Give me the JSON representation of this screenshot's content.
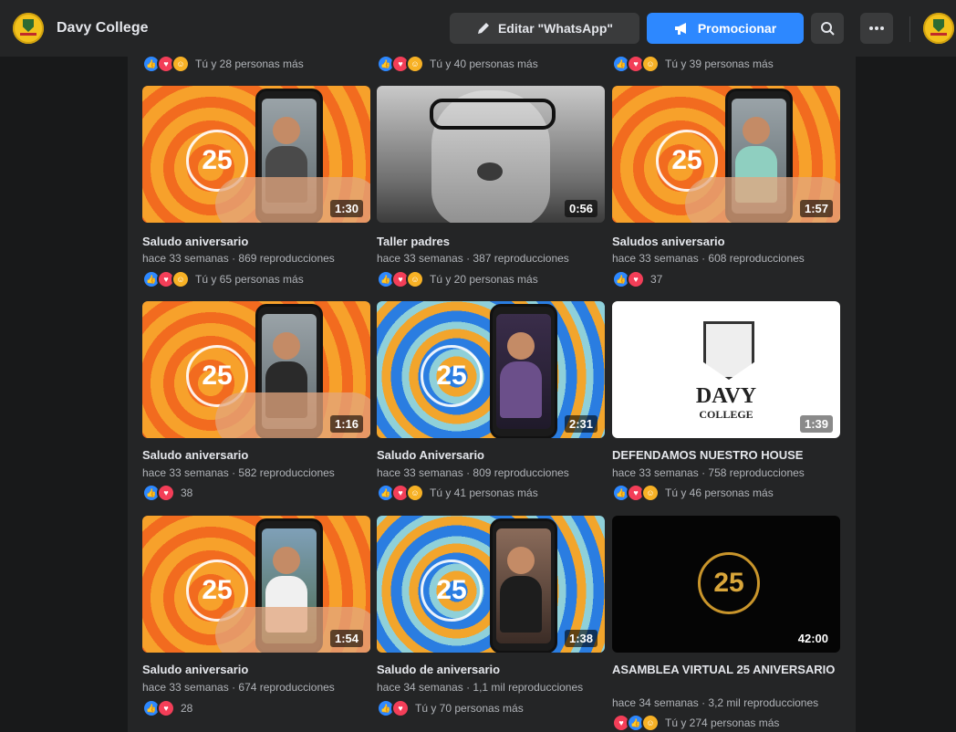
{
  "header": {
    "page_name": "Davy College",
    "edit_label": "Editar \"WhatsApp\"",
    "promote_label": "Promocionar"
  },
  "top_row_reactions": [
    {
      "text": "Tú y 28 personas más"
    },
    {
      "text": "Tú y 40 personas más"
    },
    {
      "text": "Tú y 39 personas más"
    }
  ],
  "videos": [
    {
      "title": "Saludo aniversario",
      "age": "hace 33 semanas",
      "views": "869 reproducciones",
      "duration": "1:30",
      "reactions": "Tú y 65 personas más",
      "thumb": "orange"
    },
    {
      "title": "Taller padres",
      "age": "hace 33 semanas",
      "views": "387 reproducciones",
      "duration": "0:56",
      "reactions": "Tú y 20 personas más",
      "thumb": "gray"
    },
    {
      "title": "Saludos aniversario",
      "age": "hace 33 semanas",
      "views": "608 reproducciones",
      "duration": "1:57",
      "reactions": "37",
      "thumb": "orange"
    },
    {
      "title": "Saludo aniversario",
      "age": "hace 33 semanas",
      "views": "582 reproducciones",
      "duration": "1:16",
      "reactions": "38",
      "thumb": "orange"
    },
    {
      "title": "Saludo Aniversario",
      "age": "hace 33 semanas",
      "views": "809 reproducciones",
      "duration": "2:31",
      "reactions": "Tú y 41 personas más",
      "thumb": "mixed"
    },
    {
      "title": "DEFENDAMOS NUESTRO HOUSE",
      "age": "hace 33 semanas",
      "views": "758 reproducciones",
      "duration": "1:39",
      "reactions": "Tú y 46 personas más",
      "thumb": "white"
    },
    {
      "title": "Saludo aniversario",
      "age": "hace 33 semanas",
      "views": "674 reproducciones",
      "duration": "1:54",
      "reactions": "28",
      "thumb": "orange"
    },
    {
      "title": "Saludo de aniversario",
      "age": "hace 34 semanas",
      "views": "1,1 mil reproducciones",
      "duration": "1:38",
      "reactions": "Tú y 70 personas más",
      "thumb": "mixed"
    },
    {
      "title": "ASAMBLEA VIRTUAL 25 ANIVERSARIO",
      "age": "hace 34 semanas",
      "views": "3,2 mil reproducciones",
      "duration": "42:00",
      "reactions": "Tú y 274 personas más",
      "thumb": "black"
    }
  ],
  "thumb_art": {
    "emblem": "25",
    "crest_name": "DAVY",
    "crest_sub": "COLLEGE"
  },
  "colors": {
    "background": "#18191a",
    "surface": "#242526",
    "accent": "#2d88ff",
    "text": "#e4e6eb",
    "muted": "#b0b3b8"
  }
}
